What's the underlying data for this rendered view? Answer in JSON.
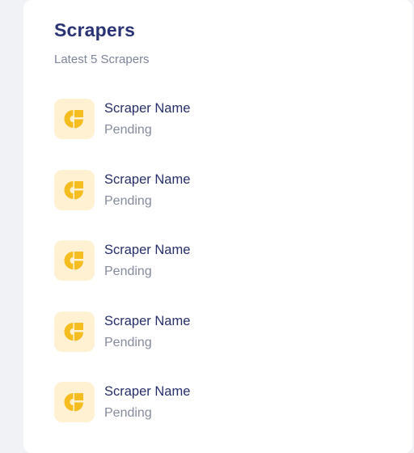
{
  "card": {
    "title": "Scrapers",
    "subtitle": "Latest 5 Scrapers"
  },
  "scrapers": [
    {
      "name": "Scraper Name",
      "status": "Pending",
      "icon": "scraper-logo-icon"
    },
    {
      "name": "Scraper Name",
      "status": "Pending",
      "icon": "scraper-logo-icon"
    },
    {
      "name": "Scraper Name",
      "status": "Pending",
      "icon": "scraper-logo-icon"
    },
    {
      "name": "Scraper Name",
      "status": "Pending",
      "icon": "scraper-logo-icon"
    },
    {
      "name": "Scraper Name",
      "status": "Pending",
      "icon": "scraper-logo-icon"
    }
  ],
  "colors": {
    "accent": "#f5bd1f",
    "icon_tile": "#fff1d1",
    "title": "#2a3474",
    "muted": "#858b9c",
    "page_background": "#f1f2f5"
  }
}
